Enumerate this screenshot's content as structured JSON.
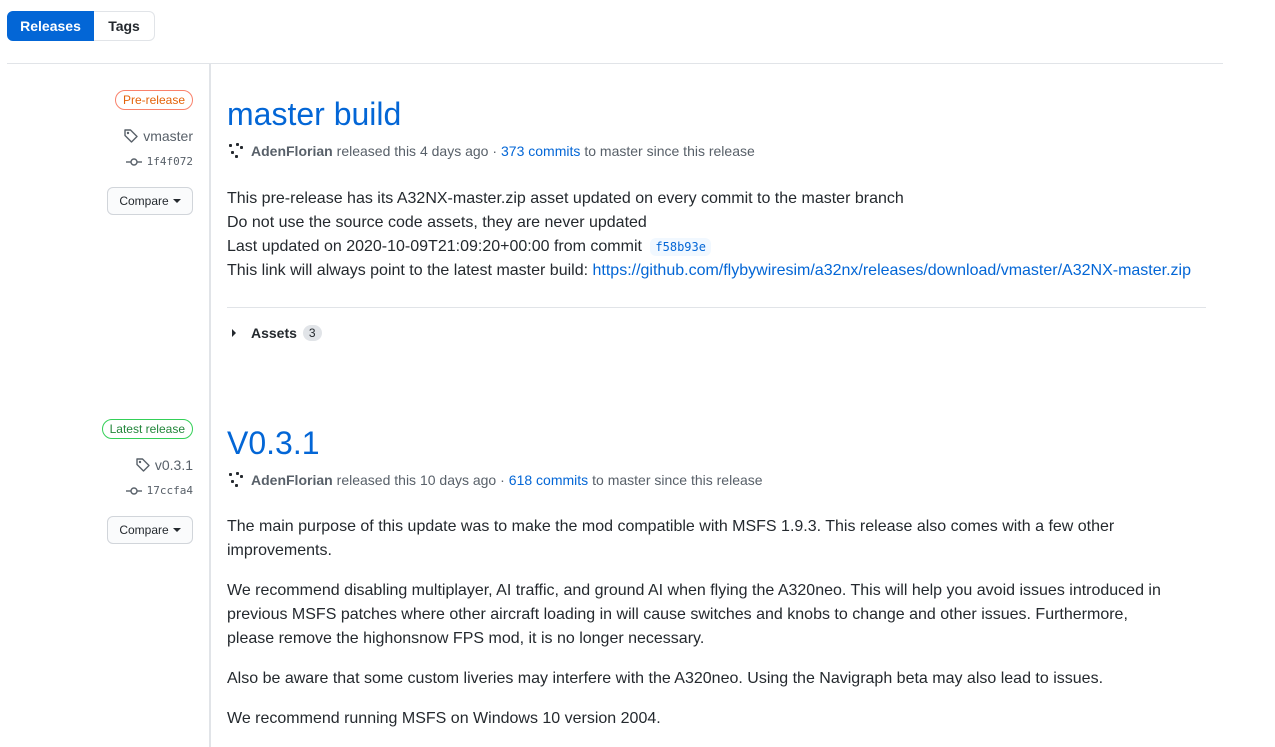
{
  "tabs": {
    "releases": "Releases",
    "tags": "Tags"
  },
  "releases": [
    {
      "badge": "Pre-release",
      "tag": "vmaster",
      "commit": "1f4f072",
      "compare": "Compare",
      "title": "master build",
      "author": "AdenFlorian",
      "released": "released this 4 days ago ·",
      "commits_link": "373 commits",
      "commits_suffix": "to master since this release",
      "lines": [
        "This pre-release has its A32NX-master.zip asset updated on every commit to the master branch",
        "Do not use the source code assets, they are never updated",
        "Last updated on 2020-10-09T21:09:20+00:00 from commit"
      ],
      "sha": "f58b93e",
      "link_prefix": "This link will always point to the latest master build:",
      "link": "https://github.com/flybywiresim/a32nx/releases/download/vmaster/A32NX-master.zip",
      "assets_label": "Assets",
      "assets_count": "3"
    },
    {
      "badge": "Latest release",
      "tag": "v0.3.1",
      "commit": "17ccfa4",
      "compare": "Compare",
      "title": "V0.3.1",
      "author": "AdenFlorian",
      "released": "released this 10 days ago ·",
      "commits_link": "618 commits",
      "commits_suffix": "to master since this release",
      "paragraphs": [
        "The main purpose of this update was to make the mod compatible with MSFS 1.9.3. This release also comes with a few other improvements.",
        "We recommend disabling multiplayer, AI traffic, and ground AI when flying the A320neo. This will help you avoid issues introduced in previous MSFS patches where other aircraft loading in will cause switches and knobs to change and other issues. Furthermore, please remove the highonsnow FPS mod, it is no longer necessary.",
        "Also be aware that some custom liveries may interfere with the A320neo. Using the Navigraph beta may also lead to issues.",
        "We recommend running MSFS on Windows 10 version 2004."
      ]
    }
  ],
  "icons": {
    "tag": "tag-icon",
    "commit": "git-commit-icon",
    "caret": "triangle-down-icon",
    "expand": "triangle-right-icon"
  },
  "colors": {
    "accent": "#0366d6",
    "prerelease": "#e36209",
    "latest": "#22863a"
  }
}
